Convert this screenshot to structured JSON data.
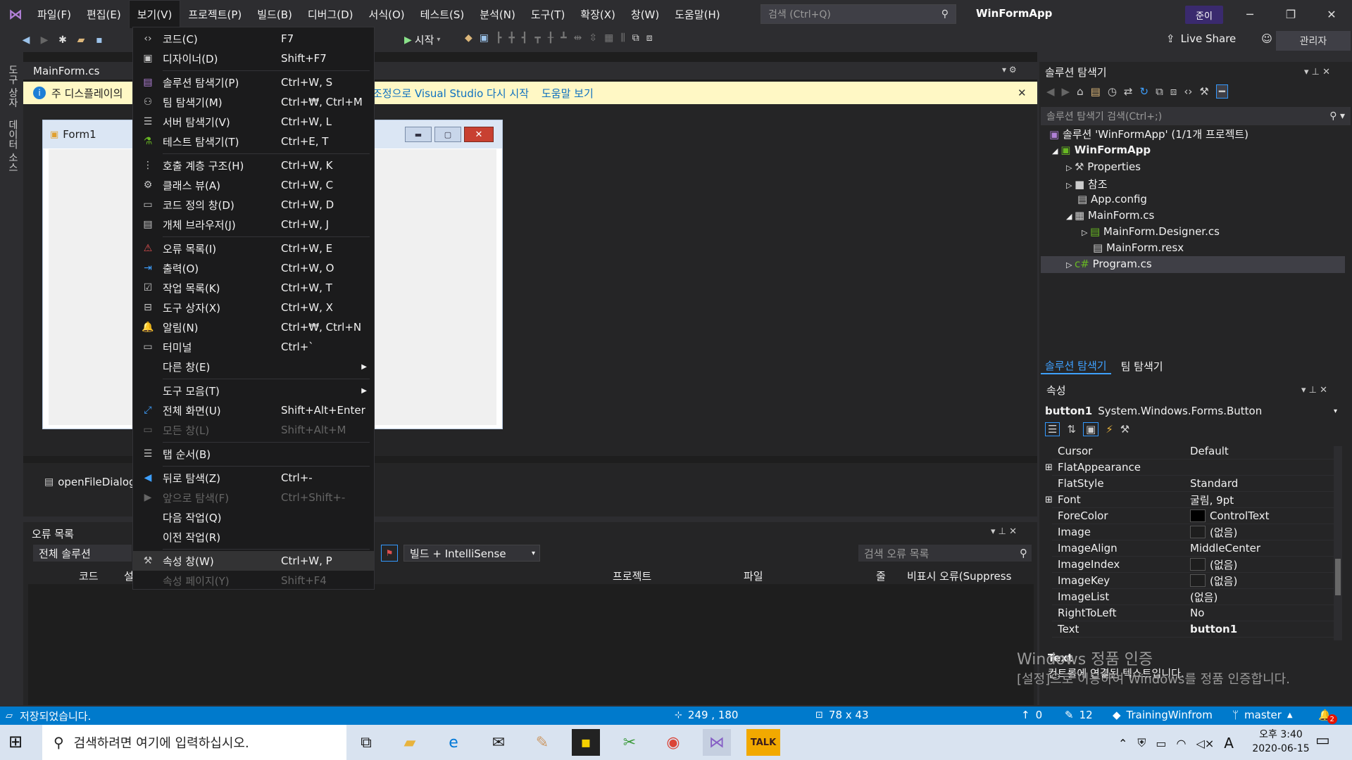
{
  "menubar": {
    "items": [
      "파일(F)",
      "편집(E)",
      "보기(V)",
      "프로젝트(P)",
      "빌드(B)",
      "디버그(D)",
      "서식(O)",
      "테스트(S)",
      "분석(N)",
      "도구(T)",
      "확장(X)",
      "창(W)",
      "도움말(H)"
    ]
  },
  "search": {
    "placeholder": "검색 (Ctrl+Q)"
  },
  "app": {
    "title": "WinFormApp",
    "user": "준이"
  },
  "toolbar": {
    "start": "시작",
    "live_share": "Live Share",
    "admin": "관리자"
  },
  "leftstrip": {
    "toolbox": "도구 상자",
    "datasource": "데이터 소스"
  },
  "editor": {
    "tab": "MainForm.cs",
    "info_prefix": "주 디스플레이의",
    "info_restart": "조정으로 Visual Studio 다시 시작",
    "info_help": "도움말 보기",
    "form_title": "Form1",
    "tray_item": "openFileDialog"
  },
  "errorlist": {
    "title": "오류 목록",
    "scope": "전체 솔루션",
    "build_filter": "빌드 + IntelliSense",
    "search": "검색 오류 목록",
    "cols": [
      "코드",
      "설",
      "프로젝트",
      "파일",
      "줄",
      "비표시 오류(Suppress"
    ]
  },
  "solution": {
    "title": "솔루션 탐색기",
    "search": "솔루션 탐색기 검색(Ctrl+;)",
    "tree": [
      "솔루션 'WinFormApp' (1/1개 프로젝트)",
      "WinFormApp",
      "Properties",
      "참조",
      "App.config",
      "MainForm.cs",
      "MainForm.Designer.cs",
      "MainForm.resx",
      "Program.cs"
    ],
    "tab_solution": "솔루션 탐색기",
    "tab_team": "팀 탐색기"
  },
  "properties": {
    "title": "속성",
    "object": "button1",
    "object_type": "System.Windows.Forms.Button",
    "rows": [
      [
        "Cursor",
        "Default"
      ],
      [
        "FlatAppearance",
        ""
      ],
      [
        "FlatStyle",
        "Standard"
      ],
      [
        "Font",
        "굴림, 9pt"
      ],
      [
        "ForeColor",
        "ControlText"
      ],
      [
        "Image",
        "(없음)"
      ],
      [
        "ImageAlign",
        "MiddleCenter"
      ],
      [
        "ImageIndex",
        "(없음)"
      ],
      [
        "ImageKey",
        "(없음)"
      ],
      [
        "ImageList",
        "(없음)"
      ],
      [
        "RightToLeft",
        "No"
      ],
      [
        "Text",
        "button1"
      ]
    ],
    "desc_title": "Text",
    "desc_text": "컨트롤에 연결된 텍스트입니다."
  },
  "watermark": {
    "line1": "Windows 정품 인증",
    "line2": "[설정]으로 이동하여 Windows를 정품 인증합니다."
  },
  "viewmenu": {
    "items": [
      [
        "코드(C)",
        "F7"
      ],
      [
        "디자이너(D)",
        "Shift+F7"
      ],
      [
        "솔루션 탐색기(P)",
        "Ctrl+W, S"
      ],
      [
        "팀 탐색기(M)",
        "Ctrl+₩, Ctrl+M"
      ],
      [
        "서버 탐색기(V)",
        "Ctrl+W, L"
      ],
      [
        "테스트 탐색기(T)",
        "Ctrl+E, T"
      ],
      [
        "호출 계층 구조(H)",
        "Ctrl+W, K"
      ],
      [
        "클래스 뷰(A)",
        "Ctrl+W, C"
      ],
      [
        "코드 정의 창(D)",
        "Ctrl+W, D"
      ],
      [
        "개체 브라우저(J)",
        "Ctrl+W, J"
      ],
      [
        "오류 목록(I)",
        "Ctrl+W, E"
      ],
      [
        "출력(O)",
        "Ctrl+W, O"
      ],
      [
        "작업 목록(K)",
        "Ctrl+W, T"
      ],
      [
        "도구 상자(X)",
        "Ctrl+W, X"
      ],
      [
        "알림(N)",
        "Ctrl+₩, Ctrl+N"
      ],
      [
        "터미널",
        "Ctrl+`"
      ],
      [
        "다른 창(E)",
        ""
      ],
      [
        "도구 모음(T)",
        ""
      ],
      [
        "전체 화면(U)",
        "Shift+Alt+Enter"
      ],
      [
        "모든 창(L)",
        "Shift+Alt+M"
      ],
      [
        "탭 순서(B)",
        ""
      ],
      [
        "뒤로 탐색(Z)",
        "Ctrl+-"
      ],
      [
        "앞으로 탐색(F)",
        "Ctrl+Shift+-"
      ],
      [
        "다음 작업(Q)",
        ""
      ],
      [
        "이전 작업(R)",
        ""
      ],
      [
        "속성 창(W)",
        "Ctrl+W, P"
      ],
      [
        "속성 페이지(Y)",
        "Shift+F4"
      ]
    ]
  },
  "status": {
    "message": "저장되었습니다.",
    "position": "249 , 180",
    "size": "78 x 43",
    "up": "0",
    "edits": "12",
    "repo": "TrainingWinfrom",
    "branch": "master",
    "notif": "2"
  },
  "taskbar": {
    "search": "검색하려면 여기에 입력하십시오.",
    "time": "오후 3:40",
    "date": "2020-06-15",
    "ime": "A"
  },
  "colors": {
    "accent": "#007acc",
    "menu_bg": "#1b1b1c",
    "info_bg": "#fff8c5"
  }
}
